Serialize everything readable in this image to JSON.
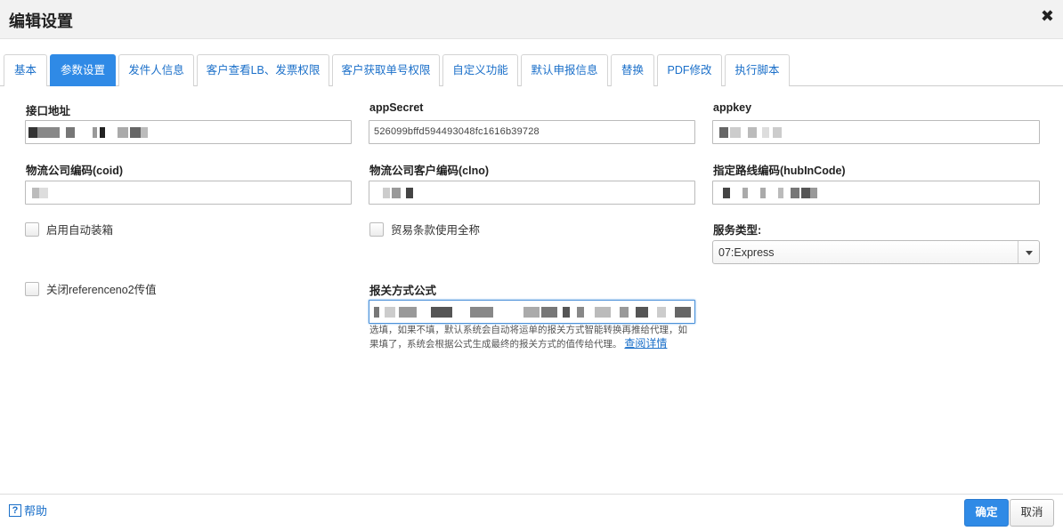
{
  "dialog": {
    "title": "编辑设置",
    "close_icon": "close-icon"
  },
  "tabs": [
    {
      "label": "基本"
    },
    {
      "label": "参数设置",
      "active": true
    },
    {
      "label": "发件人信息"
    },
    {
      "label": "客户查看LB、发票权限"
    },
    {
      "label": "客户获取单号权限"
    },
    {
      "label": "自定义功能"
    },
    {
      "label": "默认申报信息"
    },
    {
      "label": "替换"
    },
    {
      "label": "PDF修改"
    },
    {
      "label": "执行脚本"
    }
  ],
  "form": {
    "api_url": {
      "label": "接口地址",
      "value": ""
    },
    "app_secret": {
      "label": "appSecret",
      "value": "526099bffd594493048fc1616b39728"
    },
    "app_key": {
      "label": "appkey",
      "value": ""
    },
    "coid": {
      "label": "物流公司编码(coid)",
      "value": ""
    },
    "clno": {
      "label": "物流公司客户编码(clno)",
      "value": ""
    },
    "hub_in_code": {
      "label": "指定路线编码(hubInCode)",
      "value": ""
    },
    "auto_box": {
      "label": "启用自动装箱",
      "checked": false
    },
    "trade_terms_full": {
      "label": "贸易条款使用全称",
      "checked": false
    },
    "service_type": {
      "label": "服务类型:",
      "value": "07:Express"
    },
    "close_reference": {
      "label": "关闭referenceno2传值",
      "checked": false
    },
    "customs_formula": {
      "label": "报关方式公式",
      "value": "",
      "hint": "选填，如果不填，默认系统会自动将运单的报关方式智能转换再推给代理，如果填了，系统会根据公式生成最终的报关方式的值传给代理。",
      "link": "查阅详情"
    }
  },
  "footer": {
    "help_label": "帮助",
    "ok_label": "确定",
    "cancel_label": "取消"
  }
}
